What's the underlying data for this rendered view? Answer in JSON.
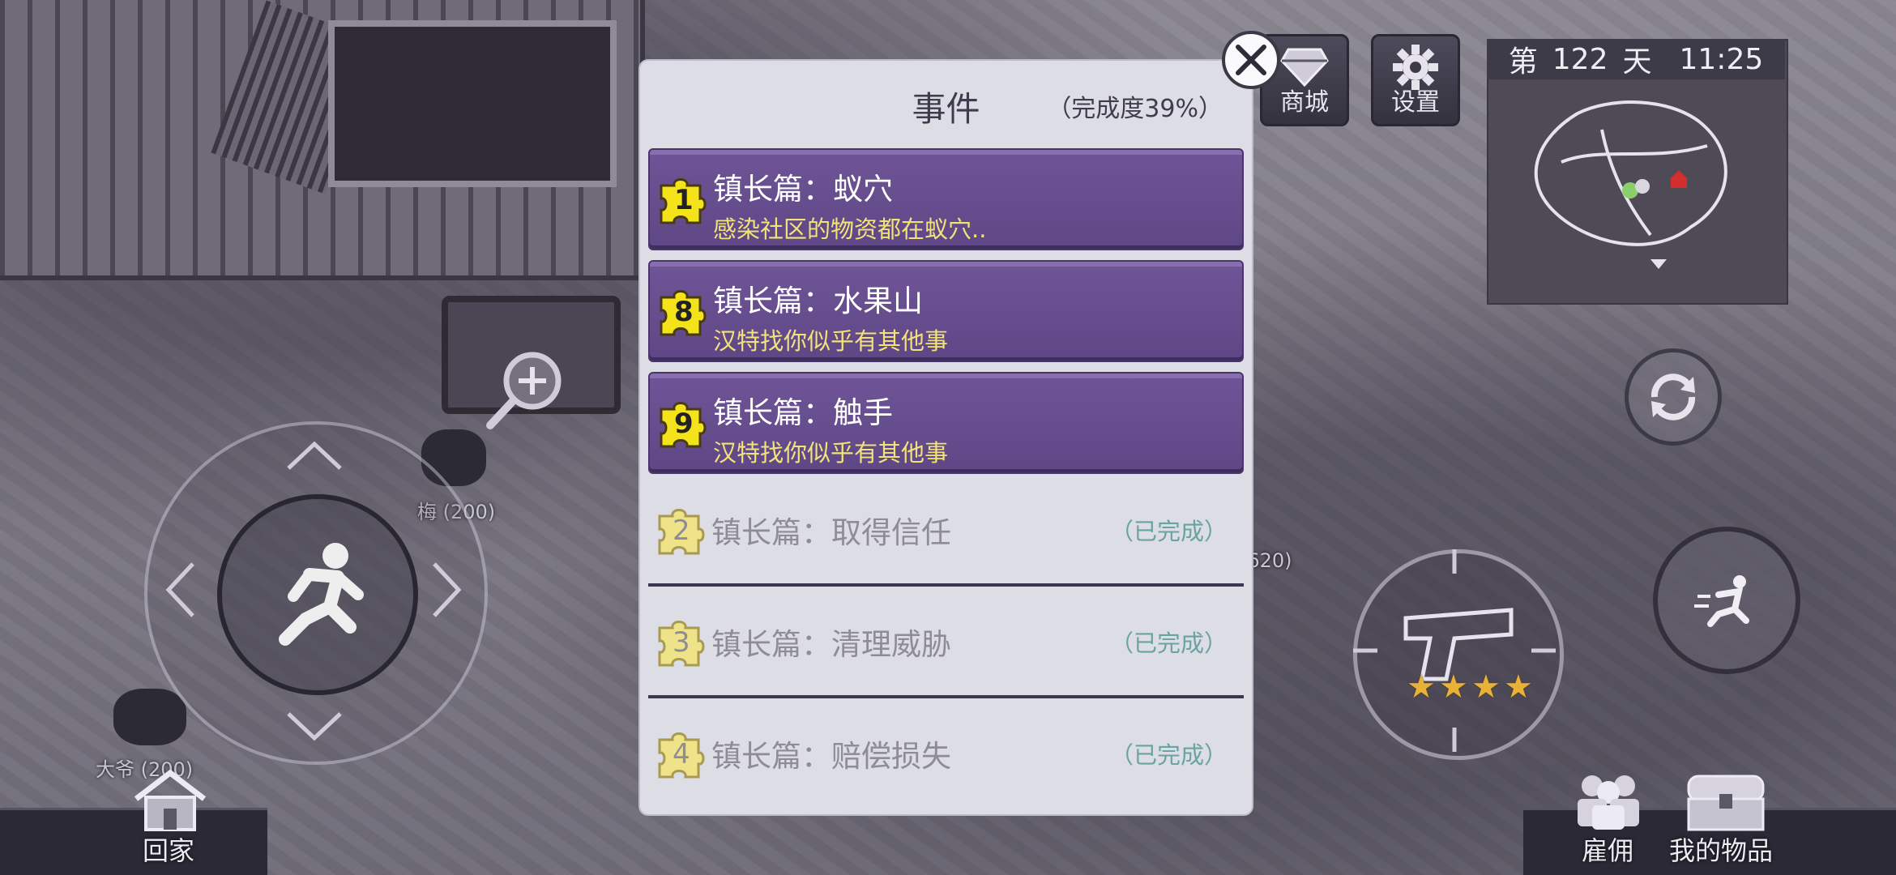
{
  "hud": {
    "day_prefix": "第",
    "day_number": "122",
    "day_suffix": "天",
    "time": "11:25",
    "shop_label": "商城",
    "settings_label": "设置",
    "home_label": "回家",
    "hire_label": "雇佣",
    "inventory_label": "我的物品",
    "weapon_stars": 4
  },
  "npcs": [
    {
      "label": "梅 (200)"
    },
    {
      "label": "大爷 (200)"
    },
    {
      "label": "(620)"
    }
  ],
  "dialog": {
    "title": "事件",
    "progress": "（完成度39%）",
    "events": [
      {
        "num": "1",
        "title": "镇长篇：蚁穴",
        "subtitle": "感染社区的物资都在蚁穴..",
        "status": ""
      },
      {
        "num": "8",
        "title": "镇长篇：水果山",
        "subtitle": "汉特找你似乎有其他事",
        "status": ""
      },
      {
        "num": "9",
        "title": "镇长篇：触手",
        "subtitle": "汉特找你似乎有其他事",
        "status": ""
      },
      {
        "num": "2",
        "title": "镇长篇：取得信任",
        "subtitle": "",
        "status": "（已完成）"
      },
      {
        "num": "3",
        "title": "镇长篇：清理威胁",
        "subtitle": "",
        "status": "（已完成）"
      },
      {
        "num": "4",
        "title": "镇长篇：赔偿损失",
        "subtitle": "",
        "status": "（已完成）"
      }
    ]
  },
  "colors": {
    "active_row": "#6e5496",
    "puzzle_yellow": "#f4e21a",
    "subtitle_yellow": "#f2e27a",
    "done_status": "#6aa3a0"
  }
}
